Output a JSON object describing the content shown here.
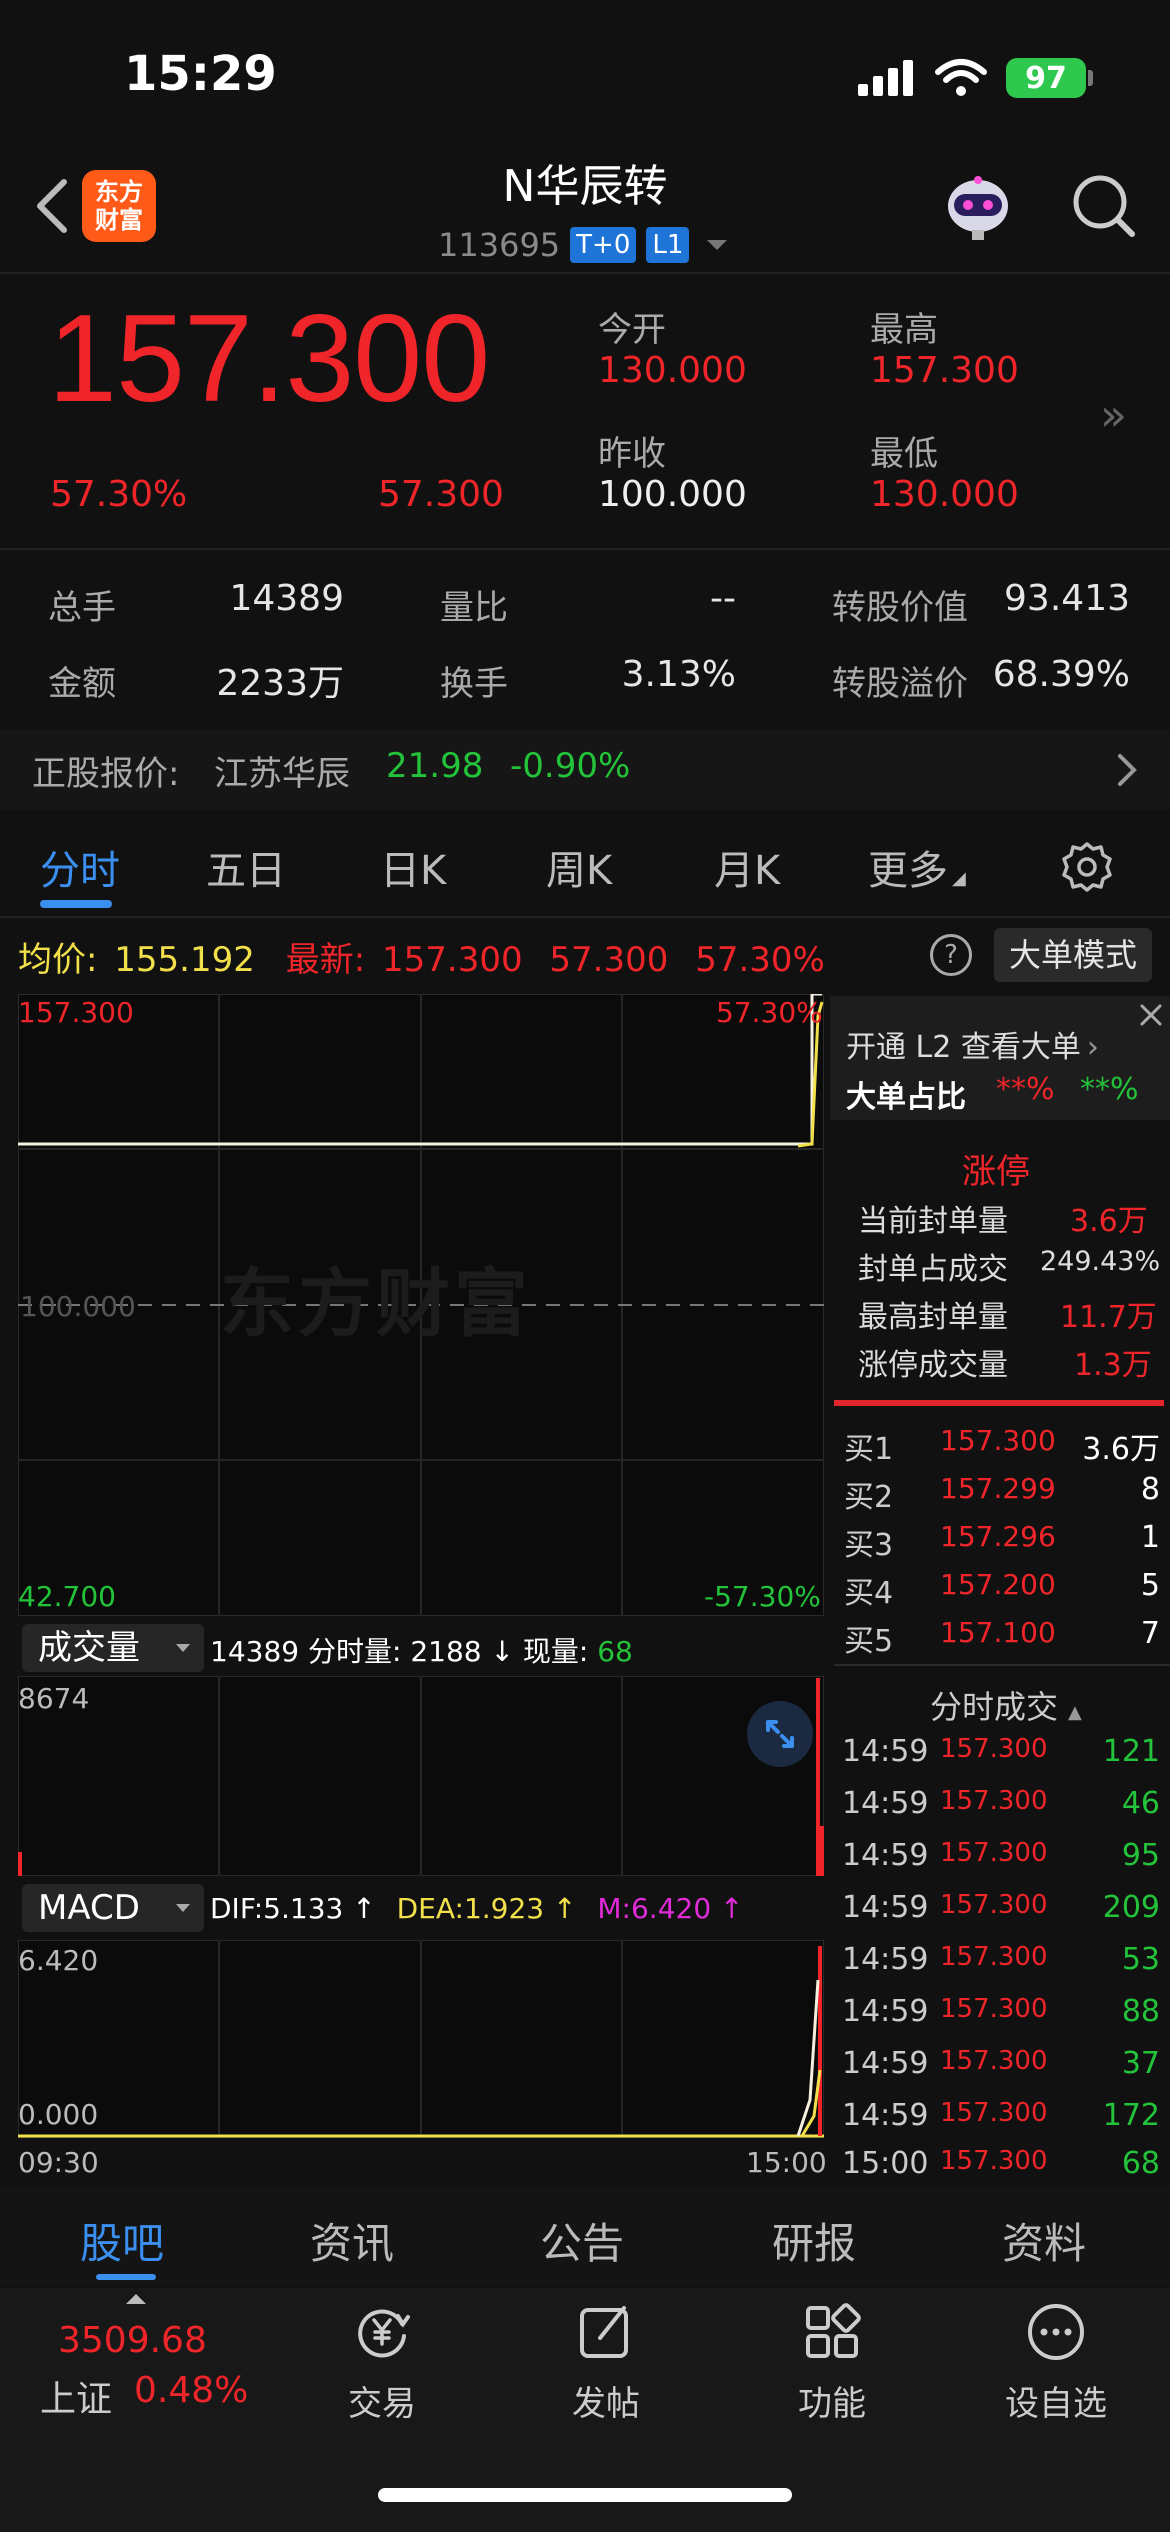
{
  "status": {
    "time": "15:29",
    "battery": "97"
  },
  "nav": {
    "logo_line1": "东方",
    "logo_line2": "财富",
    "stock_name": "N华辰转",
    "stock_code": "113695",
    "tag1": "T+0",
    "tag2": "L1"
  },
  "quote": {
    "price": "157.300",
    "change_pct": "57.30%",
    "change": "57.300",
    "open_label": "今开",
    "open": "130.000",
    "high_label": "最高",
    "high": "157.300",
    "prev_close_label": "昨收",
    "prev_close": "100.000",
    "low_label": "最低",
    "low": "130.000"
  },
  "stats": {
    "volume_label": "总手",
    "volume": "14389",
    "vol_ratio_label": "量比",
    "vol_ratio": "--",
    "conv_value_label": "转股价值",
    "conv_value": "93.413",
    "amount_label": "金额",
    "amount": "2233万",
    "turnover_label": "换手",
    "turnover": "3.13%",
    "premium_label": "转股溢价",
    "premium": "68.39%"
  },
  "underlying": {
    "label": "正股报价:",
    "name": "江苏华辰",
    "price": "21.98",
    "change": "-0.90%"
  },
  "tabs": [
    "分时",
    "五日",
    "日K",
    "周K",
    "月K",
    "更多"
  ],
  "info": {
    "avg_label": "均价:",
    "avg": "155.192",
    "latest_label": "最新:",
    "latest": "157.300",
    "change": "57.300",
    "change_pct": "57.30%",
    "help": "?",
    "big_order_mode": "大单模式"
  },
  "chart": {
    "top_price": "157.300",
    "top_pct": "57.30%",
    "bottom_price": "42.700",
    "bottom_pct": "-57.30%",
    "mid_price": "100.000",
    "watermark": "东方财富",
    "volume_selector": "成交量",
    "volume_info_total": "14389",
    "volume_info_minute_label": "分时量:",
    "volume_info_minute": "2188",
    "volume_info_now_label": "现量:",
    "volume_info_now": "68",
    "volume_max": "8674",
    "macd_selector": "MACD",
    "dif": "DIF:5.133 ↑",
    "dea": "DEA:1.923 ↑",
    "m": "M:6.420 ↑",
    "macd_top": "6.420",
    "macd_zero": "0.000",
    "time_start": "09:30",
    "time_end": "15:00"
  },
  "panel": {
    "l2_promo": "开通 L2 查看大单",
    "big_ratio_label": "大单占比",
    "big_ratio_red": "**%",
    "big_ratio_green": "**%",
    "limit_up": "涨停",
    "seal_qty_label": "当前封单量",
    "seal_qty": "3.6万",
    "seal_ratio_label": "封单占成交",
    "seal_ratio": "249.43%",
    "max_seal_label": "最高封单量",
    "max_seal": "11.7万",
    "limit_vol_label": "涨停成交量",
    "limit_vol": "1.3万",
    "bids": [
      {
        "label": "买1",
        "price": "157.300",
        "qty": "3.6万"
      },
      {
        "label": "买2",
        "price": "157.299",
        "qty": "8"
      },
      {
        "label": "买3",
        "price": "157.296",
        "qty": "1"
      },
      {
        "label": "买4",
        "price": "157.200",
        "qty": "5"
      },
      {
        "label": "买5",
        "price": "157.100",
        "qty": "7"
      }
    ],
    "trades_title": "分时成交",
    "trades": [
      {
        "time": "14:59",
        "price": "157.300",
        "qty": "121"
      },
      {
        "time": "14:59",
        "price": "157.300",
        "qty": "46"
      },
      {
        "time": "14:59",
        "price": "157.300",
        "qty": "95"
      },
      {
        "time": "14:59",
        "price": "157.300",
        "qty": "209"
      },
      {
        "time": "14:59",
        "price": "157.300",
        "qty": "53"
      },
      {
        "time": "14:59",
        "price": "157.300",
        "qty": "88"
      },
      {
        "time": "14:59",
        "price": "157.300",
        "qty": "37"
      },
      {
        "time": "14:59",
        "price": "157.300",
        "qty": "172"
      },
      {
        "time": "15:00",
        "price": "157.300",
        "qty": "68"
      }
    ]
  },
  "bottom_tabs": [
    "股吧",
    "资讯",
    "公告",
    "研报",
    "资料"
  ],
  "toolbar": {
    "index_value": "3509.68",
    "index_name": "上证",
    "index_change": "0.48%",
    "trade": "交易",
    "post": "发帖",
    "functions": "功能",
    "watchlist": "设自选"
  },
  "colors": {
    "up": "#f0252a",
    "down": "#23c33a",
    "accent": "#3b8fef",
    "avg_line": "#f2e04a"
  }
}
